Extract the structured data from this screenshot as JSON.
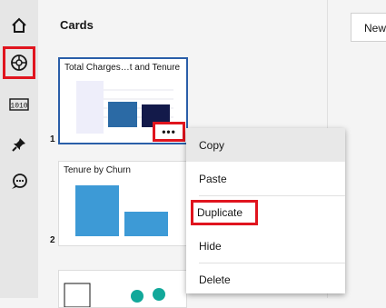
{
  "panel": {
    "title": "Cards"
  },
  "header": {
    "new_label": "New"
  },
  "rail": {
    "icons": [
      "home-icon",
      "compass-icon",
      "data-binary-icon",
      "pin-icon",
      "chat-bot-icon"
    ]
  },
  "cards": [
    {
      "title": "Total Charges…t and Tenure",
      "number": "1"
    },
    {
      "title": "Tenure by Churn",
      "number": "2"
    },
    {
      "title": "",
      "number": ""
    }
  ],
  "card_actions": {
    "more_label": "•••"
  },
  "context_menu": {
    "items": [
      "Copy",
      "Paste",
      "Duplicate",
      "Hide",
      "Delete"
    ]
  },
  "colors": {
    "highlight": "#e0141e",
    "selected_border": "#2a5ea8",
    "bar_dark": "#131a4a",
    "bar_mid": "#2b6aa5",
    "bar_light": "#3d9ad6",
    "teal": "#12a89a"
  }
}
